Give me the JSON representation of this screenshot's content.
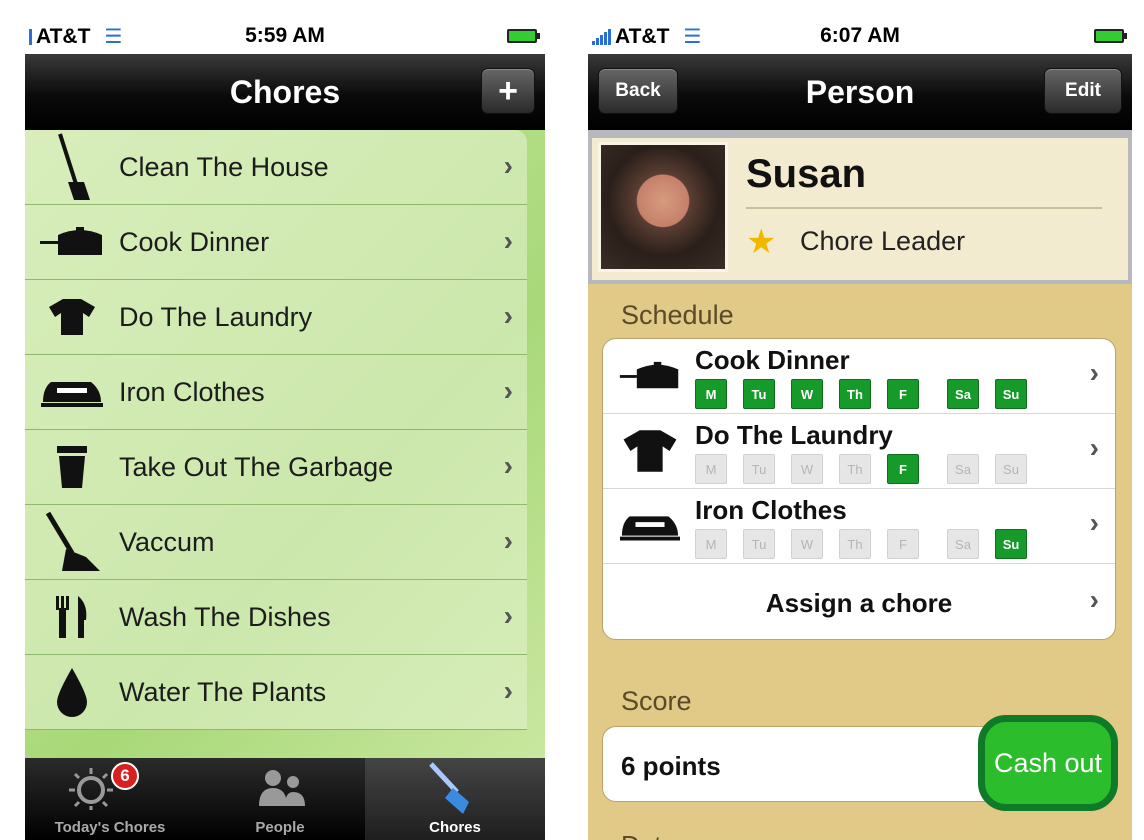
{
  "left": {
    "status": {
      "carrier": "AT&T",
      "time": "5:59 AM"
    },
    "nav": {
      "title": "Chores",
      "add_label": "+"
    },
    "chores": [
      {
        "label": "Clean The House",
        "icon": "broom-icon"
      },
      {
        "label": "Cook Dinner",
        "icon": "pot-icon"
      },
      {
        "label": "Do The Laundry",
        "icon": "shirt-icon"
      },
      {
        "label": "Iron Clothes",
        "icon": "iron-icon"
      },
      {
        "label": "Take Out The Garbage",
        "icon": "trash-can-icon"
      },
      {
        "label": "Vaccum",
        "icon": "vacuum-icon"
      },
      {
        "label": "Wash The Dishes",
        "icon": "fork-knife-icon"
      },
      {
        "label": "Water The Plants",
        "icon": "water-drop-icon"
      }
    ],
    "tabs": [
      {
        "label": "Today's Chores",
        "icon": "sun-icon",
        "badge": "6"
      },
      {
        "label": "People",
        "icon": "people-icon"
      },
      {
        "label": "Chores",
        "icon": "brush-icon",
        "active": true
      }
    ]
  },
  "right": {
    "status": {
      "carrier": "AT&T",
      "time": "6:07 AM"
    },
    "nav": {
      "title": "Person",
      "back_label": "Back",
      "edit_label": "Edit"
    },
    "profile": {
      "name": "Susan",
      "role": "Chore Leader",
      "role_badge": "1"
    },
    "schedule_label": "Schedule",
    "schedule": [
      {
        "name": "Cook Dinner",
        "icon": "pot-icon",
        "days": [
          {
            "d": "M",
            "on": true
          },
          {
            "d": "Tu",
            "on": true
          },
          {
            "d": "W",
            "on": true
          },
          {
            "d": "Th",
            "on": true
          },
          {
            "d": "F",
            "on": true
          },
          {
            "d": "Sa",
            "on": true
          },
          {
            "d": "Su",
            "on": true
          }
        ]
      },
      {
        "name": "Do The Laundry",
        "icon": "shirt-icon",
        "days": [
          {
            "d": "M",
            "on": false
          },
          {
            "d": "Tu",
            "on": false
          },
          {
            "d": "W",
            "on": false
          },
          {
            "d": "Th",
            "on": false
          },
          {
            "d": "F",
            "on": true
          },
          {
            "d": "Sa",
            "on": false
          },
          {
            "d": "Su",
            "on": false
          }
        ]
      },
      {
        "name": "Iron Clothes",
        "icon": "iron-icon",
        "days": [
          {
            "d": "M",
            "on": false
          },
          {
            "d": "Tu",
            "on": false
          },
          {
            "d": "W",
            "on": false
          },
          {
            "d": "Th",
            "on": false
          },
          {
            "d": "F",
            "on": false
          },
          {
            "d": "Sa",
            "on": false
          },
          {
            "d": "Su",
            "on": true
          }
        ]
      }
    ],
    "assign_label": "Assign a chore",
    "score_label": "Score",
    "score_value": "6 points",
    "cashout_label": "Cash out",
    "data_label": "Data"
  },
  "colors": {
    "accent_green": "#169a2a",
    "list_bg": "#a8d878",
    "person_bg": "#e1c987"
  }
}
